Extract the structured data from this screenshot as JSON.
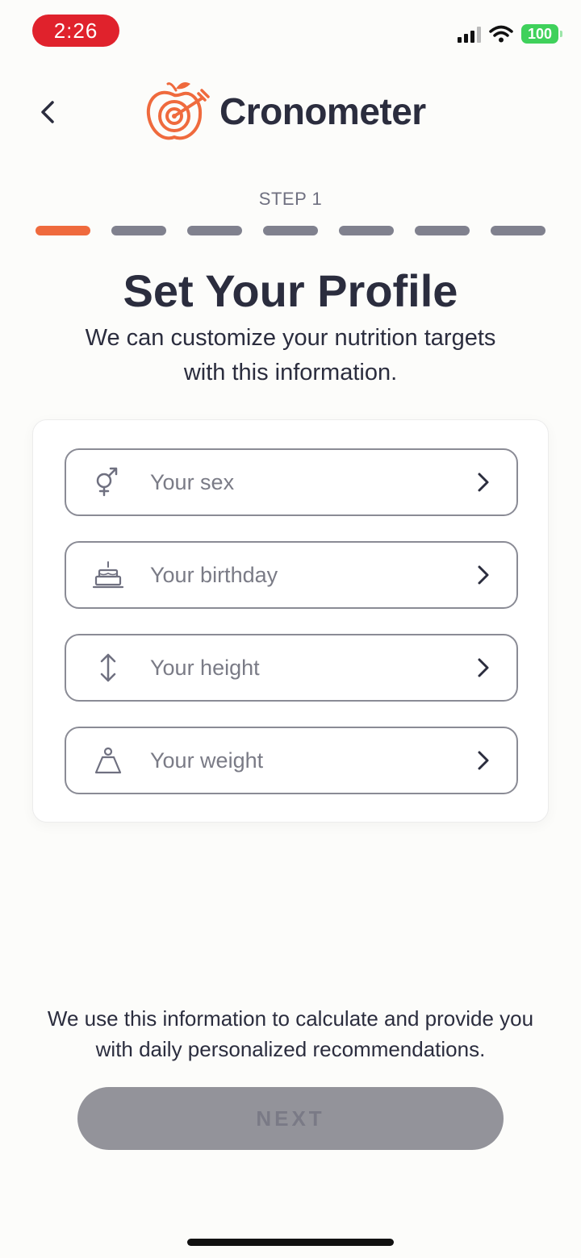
{
  "status_bar": {
    "time": "2:26",
    "battery": "100"
  },
  "header": {
    "brand": "Cronometer"
  },
  "stepper": {
    "label": "STEP 1",
    "total_steps": 7,
    "current_step": 1
  },
  "profile": {
    "title": "Set Your Profile",
    "subtitle": "We can customize your nutrition targets with this information.",
    "fields": [
      {
        "label": "Your sex",
        "icon": "gender-icon"
      },
      {
        "label": "Your birthday",
        "icon": "birthday-cake-icon"
      },
      {
        "label": "Your height",
        "icon": "height-arrows-icon"
      },
      {
        "label": "Your weight",
        "icon": "weight-icon"
      }
    ]
  },
  "footer": {
    "note": "We use this information to calculate and provide you with daily personalized recommendations.",
    "next_label": "NEXT"
  },
  "colors": {
    "accent": "#ef6a3d",
    "text": "#2b2d3e",
    "inactive_step": "#80818e",
    "disabled_button": "#93939a",
    "time_pill": "#e0222c",
    "battery": "#3fd15b"
  }
}
